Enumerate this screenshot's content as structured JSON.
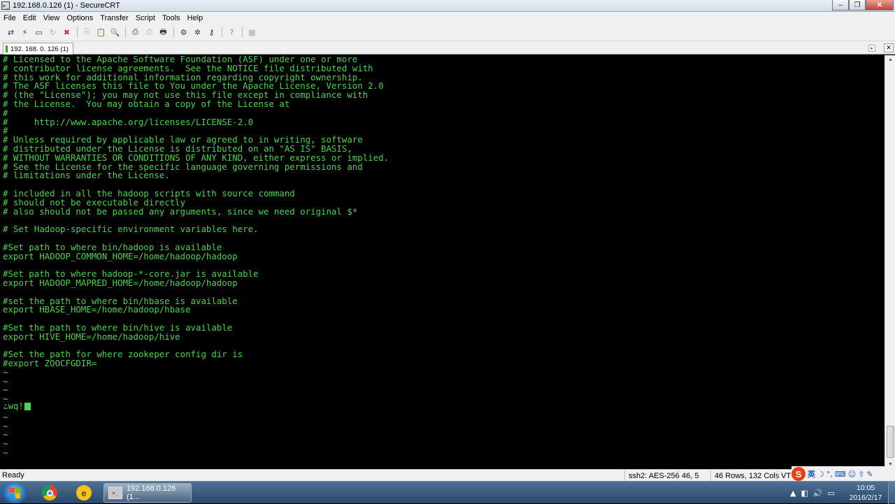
{
  "window": {
    "title": "192.168.0.126 (1) - SecureCRT",
    "app_icon_glyph": ">_",
    "controls": {
      "minimize": "‒",
      "maximize": "❐",
      "close": "✕"
    }
  },
  "menu": [
    "File",
    "Edit",
    "View",
    "Options",
    "Transfer",
    "Script",
    "Tools",
    "Help"
  ],
  "toolbar": {
    "icons": [
      "connect-icon",
      "quick-connect-icon",
      "connect-tab-icon",
      "reconnect-icon",
      "disconnect-icon",
      "copy-icon",
      "paste-icon",
      "find-icon",
      "print-icon",
      "print-selection-icon",
      "print-setup-icon",
      "session-options-icon",
      "global-options-icon",
      "keymap-icon",
      "help-icon",
      "tab-window-icon"
    ]
  },
  "tab": {
    "label": "192. 168. 0. 126  (1)",
    "close_glyph": "✕",
    "scroll_glyph": "▸"
  },
  "terminal": {
    "lines": [
      "# Licensed to the Apache Software Foundation (ASF) under one or more",
      "# contributor license agreements.  See the NOTICE file distributed with",
      "# this work for additional information regarding copyright ownership.",
      "# The ASF licenses this file to You under the Apache License, Version 2.0",
      "# (the \"License\"); you may not use this file except in compliance with",
      "# the License.  You may obtain a copy of the License at",
      "#",
      "#     http://www.apache.org/licenses/LICENSE-2.0",
      "#",
      "# Unless required by applicable law or agreed to in writing, software",
      "# distributed under the License is distributed on an \"AS IS\" BASIS,",
      "# WITHOUT WARRANTIES OR CONDITIONS OF ANY KIND, either express or implied.",
      "# See the License for the specific language governing permissions and",
      "# limitations under the License.",
      "",
      "# included in all the hadoop scripts with source command",
      "# should not be executable directly",
      "# also should not be passed any arguments, since we need original $*",
      "",
      "# Set Hadoop-specific environment variables here.",
      "",
      "#Set path to where bin/hadoop is available",
      "export HADOOP_COMMON_HOME=/home/hadoop/hadoop",
      "",
      "#Set path to where hadoop-*-core.jar is available",
      "export HADOOP_MAPRED_HOME=/home/hadoop/hadoop",
      "",
      "#set the path to where bin/hbase is available",
      "export HBASE_HOME=/home/hadoop/hbase",
      "",
      "#Set the path to where bin/hive is available",
      "export HIVE_HOME=/home/hadoop/hive",
      "",
      "#Set the path for where zookeper config dir is",
      "#export ZOOCFGDIR=",
      "~",
      "~",
      "~",
      "~",
      "~",
      "~",
      "~",
      "~",
      "~",
      "~"
    ],
    "command": ":wq!"
  },
  "status": {
    "ready": "Ready",
    "cipher": "ssh2: AES-256",
    "cursor_pos": "46,  5",
    "size": "46 Rows, 132 Cols",
    "emulation": "VT1"
  },
  "ime": {
    "logo": "S",
    "lang": "英",
    "icons": [
      "☽",
      "°,",
      "⌨",
      "☺",
      "⇧",
      "✎"
    ]
  },
  "taskbar": {
    "task_label": "192.168.0.126 (1...",
    "uc_glyph": "e",
    "tray_icons": [
      "▲",
      "◧",
      "🔊",
      "▭"
    ],
    "clock_time": "10:05",
    "clock_date": "2016/2/17"
  },
  "colors": {
    "terminal_fg": "#4bd34b",
    "terminal_bg": "#000000"
  }
}
